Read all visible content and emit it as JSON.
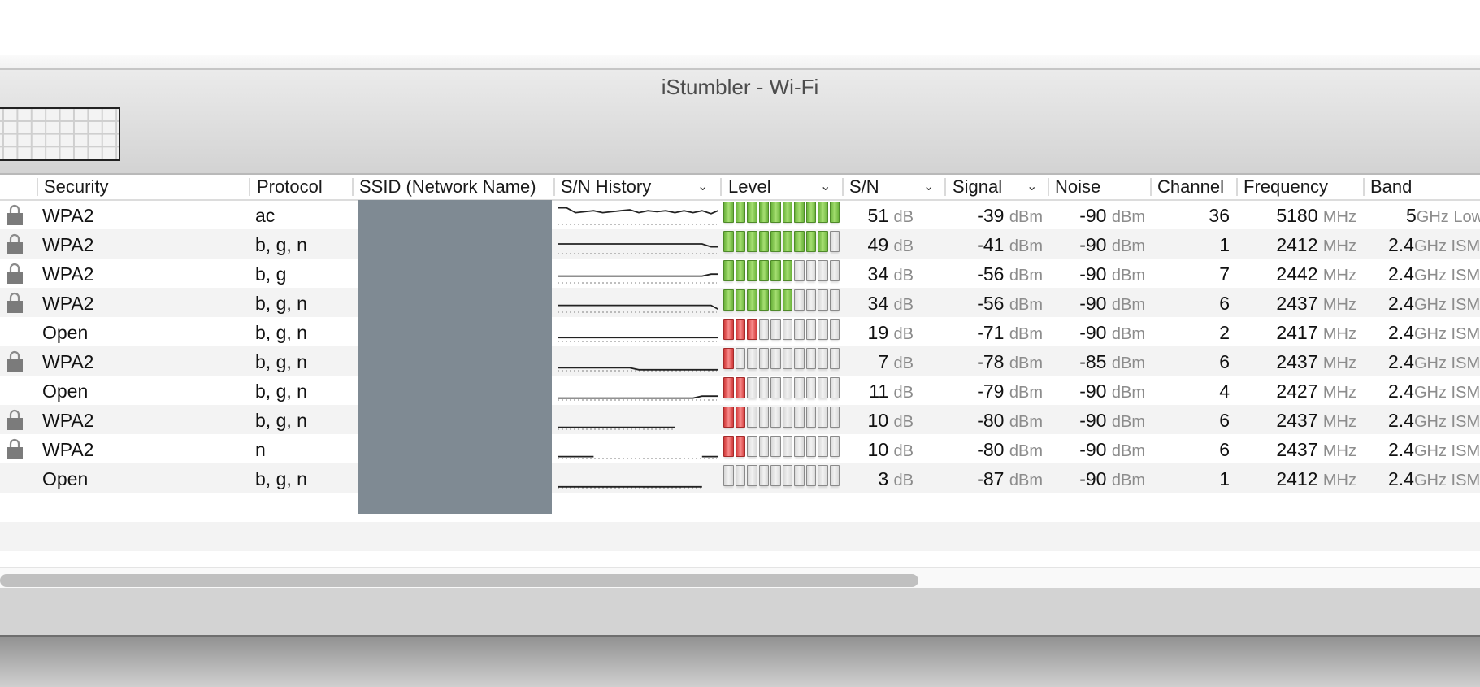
{
  "window": {
    "title": "iStumbler - Wi-Fi"
  },
  "table": {
    "columns": [
      {
        "key": "security",
        "label": "Security",
        "sortable": false
      },
      {
        "key": "protocol",
        "label": "Protocol",
        "sortable": false
      },
      {
        "key": "ssid",
        "label": "SSID (Network Name)",
        "sortable": false
      },
      {
        "key": "sn_history",
        "label": "S/N History",
        "sortable": true
      },
      {
        "key": "level",
        "label": "Level",
        "sortable": true
      },
      {
        "key": "sn",
        "label": "S/N",
        "sortable": true
      },
      {
        "key": "signal",
        "label": "Signal",
        "sortable": true
      },
      {
        "key": "noise",
        "label": "Noise",
        "sortable": false
      },
      {
        "key": "channel",
        "label": "Channel",
        "sortable": false
      },
      {
        "key": "frequency",
        "label": "Frequency",
        "sortable": false
      },
      {
        "key": "band",
        "label": "Band",
        "sortable": false
      }
    ],
    "units": {
      "sn": "dB",
      "signal": "dBm",
      "noise": "dBm",
      "frequency": "MHz"
    },
    "level_segments": 10,
    "ssid_redacted": true,
    "rows": [
      {
        "locked": true,
        "security": "WPA2",
        "protocol": "ac",
        "level": 10,
        "level_color": "green",
        "sn": "51",
        "signal": "-39",
        "noise": "-90",
        "channel": "36",
        "frequency": "5180",
        "band_value": "5",
        "band_suffix": "GHz Low",
        "history": [
          0.85,
          0.85,
          0.6,
          0.65,
          0.7,
          0.6,
          0.65,
          0.7,
          0.75,
          0.6,
          0.7,
          0.65,
          0.7,
          0.6,
          0.7,
          0.6,
          0.7,
          0.55,
          0.75
        ]
      },
      {
        "locked": true,
        "security": "WPA2",
        "protocol": "b, g, n",
        "level": 9,
        "level_color": "green",
        "sn": "49",
        "signal": "-41",
        "noise": "-90",
        "channel": "1",
        "frequency": "2412",
        "band_value": "2.4",
        "band_suffix": "GHz ISM",
        "history": [
          0.5,
          0.5,
          0.5,
          0.5,
          0.5,
          0.5,
          0.5,
          0.5,
          0.5,
          0.5,
          0.5,
          0.5,
          0.5,
          0.5,
          0.5,
          0.5,
          0.5,
          0.35,
          0.35
        ]
      },
      {
        "locked": true,
        "security": "WPA2",
        "protocol": "b, g",
        "level": 6,
        "level_color": "green",
        "sn": "34",
        "signal": "-56",
        "noise": "-90",
        "channel": "7",
        "frequency": "2442",
        "band_value": "2.4",
        "band_suffix": "GHz ISM",
        "history": [
          0.35,
          0.35,
          0.35,
          0.35,
          0.35,
          0.35,
          0.35,
          0.35,
          0.35,
          0.35,
          0.35,
          0.35,
          0.35,
          0.35,
          0.35,
          0.35,
          0.35,
          0.45,
          0.45
        ]
      },
      {
        "locked": true,
        "security": "WPA2",
        "protocol": "b, g, n",
        "level": 6,
        "level_color": "green",
        "sn": "34",
        "signal": "-56",
        "noise": "-90",
        "channel": "6",
        "frequency": "2437",
        "band_value": "2.4",
        "band_suffix": "GHz ISM",
        "history": [
          0.35,
          0.35,
          0.35,
          0.35,
          0.35,
          0.35,
          0.35,
          0.35,
          0.35,
          0.35,
          0.35,
          0.35,
          0.35,
          0.35,
          0.35,
          0.35,
          0.35,
          0.35,
          0.1
        ]
      },
      {
        "locked": false,
        "security": "Open",
        "protocol": "b, g, n",
        "level": 3,
        "level_color": "red",
        "sn": "19",
        "signal": "-71",
        "noise": "-90",
        "channel": "2",
        "frequency": "2417",
        "band_value": "2.4",
        "band_suffix": "GHz ISM",
        "history": [
          0.2,
          0.2,
          0.2,
          0.2,
          0.2,
          0.2,
          0.2,
          0.2,
          0.2,
          0.2,
          0.2,
          0.2,
          0.2,
          0.2,
          0.2,
          0.2,
          0.2,
          0.2,
          0.2
        ]
      },
      {
        "locked": true,
        "security": "WPA2",
        "protocol": "b, g, n",
        "level": 1,
        "level_color": "red",
        "sn": "7",
        "signal": "-78",
        "noise": "-85",
        "channel": "6",
        "frequency": "2437",
        "band_value": "2.4",
        "band_suffix": "GHz ISM",
        "history": [
          0.15,
          0.15,
          0.15,
          0.15,
          0.15,
          0.15,
          0.15,
          0.15,
          0.15,
          0.05,
          0.05,
          0.05,
          0.05,
          0.05,
          0.05,
          0.05,
          0.05,
          0.05,
          0.05
        ]
      },
      {
        "locked": false,
        "security": "Open",
        "protocol": "b, g, n",
        "level": 2,
        "level_color": "red",
        "sn": "11",
        "signal": "-79",
        "noise": "-90",
        "channel": "4",
        "frequency": "2427",
        "band_value": "2.4",
        "band_suffix": "GHz ISM",
        "history": [
          0.1,
          0.1,
          0.1,
          0.1,
          0.1,
          0.1,
          0.1,
          0.1,
          0.1,
          0.1,
          0.1,
          0.1,
          0.1,
          0.1,
          0.1,
          0.1,
          0.2,
          0.2,
          0.2
        ]
      },
      {
        "locked": true,
        "security": "WPA2",
        "protocol": "b, g, n",
        "level": 2,
        "level_color": "red",
        "sn": "10",
        "signal": "-80",
        "noise": "-90",
        "channel": "6",
        "frequency": "2437",
        "band_value": "2.4",
        "band_suffix": "GHz ISM",
        "history": [
          0.1,
          0.1,
          0.1,
          0.1,
          0.1,
          0.1,
          0.1,
          0.1,
          0.1,
          0.1,
          0.1,
          0.1,
          0.1,
          0.1
        ]
      },
      {
        "locked": true,
        "security": "WPA2",
        "protocol": "n",
        "level": 2,
        "level_color": "red",
        "sn": "10",
        "signal": "-80",
        "noise": "-90",
        "channel": "6",
        "frequency": "2437",
        "band_value": "2.4",
        "band_suffix": "GHz ISM",
        "history": [
          0.1,
          0.1,
          0.1,
          0.1,
          0.1,
          null,
          null,
          null,
          null,
          null,
          null,
          null,
          null,
          null,
          null,
          null,
          0.1,
          0.1,
          0.1
        ]
      },
      {
        "locked": false,
        "security": "Open",
        "protocol": "b, g, n",
        "level": 0,
        "level_color": "gray",
        "sn": "3",
        "signal": "-87",
        "noise": "-90",
        "channel": "1",
        "frequency": "2412",
        "band_value": "2.4",
        "band_suffix": "GHz ISM",
        "history": [
          0.05,
          0.05,
          0.05,
          0.05,
          0.05,
          0.05,
          0.05,
          0.05,
          0.05,
          0.05,
          0.05,
          0.05,
          0.05,
          0.05,
          0.05,
          0.05,
          0.05
        ]
      }
    ]
  },
  "scrollbar": {
    "horizontal_thumb_fraction": 0.62,
    "horizontal_position": 0
  }
}
